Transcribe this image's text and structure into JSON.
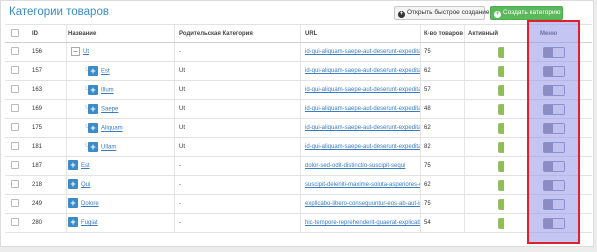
{
  "header": {
    "title": "Категории товаров",
    "quick_create_label": "Открыть быстрое создание",
    "create_label": "Создать категорию"
  },
  "columns": {
    "id": "ID",
    "name": "Название",
    "parent": "Родительская Категория",
    "url": "URL",
    "count": "К-во товаров",
    "active": "Активный",
    "menu": "Меню"
  },
  "rows": [
    {
      "id": "156",
      "name": "Ut",
      "level": 0,
      "expanded": true,
      "parent": "-",
      "url": "id-qui-aliquam-saepe-aut-deserunt-expedita",
      "count": "75",
      "active": true,
      "menu": false
    },
    {
      "id": "157",
      "name": "Est",
      "level": 1,
      "parent": "Ut",
      "url": "id-qui-aliquam-saepe-aut-deserunt-expedita/recusan...",
      "count": "62",
      "active": true,
      "menu": false
    },
    {
      "id": "163",
      "name": "Illum",
      "level": 1,
      "parent": "Ut",
      "url": "id-qui-aliquam-saepe-aut-deserunt-expedita/qui-dolo...",
      "count": "57",
      "active": true,
      "menu": false
    },
    {
      "id": "169",
      "name": "Saepe",
      "level": 1,
      "parent": "Ut",
      "url": "id-qui-aliquam-saepe-aut-deserunt-expedita/corporis...",
      "count": "48",
      "active": true,
      "menu": false
    },
    {
      "id": "175",
      "name": "Aliquam",
      "level": 1,
      "parent": "Ut",
      "url": "id-qui-aliquam-saepe-aut-deserunt-expedita/explicab...",
      "count": "62",
      "active": true,
      "menu": false
    },
    {
      "id": "181",
      "name": "Ullam",
      "level": 1,
      "parent": "Ut",
      "url": "id-qui-aliquam-saepe-aut-deserunt-expedita/quia-offi...",
      "count": "82",
      "active": true,
      "menu": false
    },
    {
      "id": "187",
      "name": "Est",
      "level": 0,
      "parent": "-",
      "url": "dolor-sed-odit-distinctio-suscipit-sequi",
      "count": "75",
      "active": true,
      "menu": false
    },
    {
      "id": "218",
      "name": "Qui",
      "level": 0,
      "parent": "-",
      "url": "suscipit-deleniti-maxime-soluta-asperiores-excepturi",
      "count": "62",
      "active": true,
      "menu": false
    },
    {
      "id": "249",
      "name": "Dolore",
      "level": 0,
      "parent": "-",
      "url": "explicabo-libero-consequuntur-eos-ab-aut-impedit-vo...",
      "count": "75",
      "active": true,
      "menu": false
    },
    {
      "id": "280",
      "name": "Fugiat",
      "level": 0,
      "parent": "-",
      "url": "hic-tempore-reprehenderit-quaerat-explicabo-sed-dig...",
      "count": "54",
      "active": true,
      "menu": false
    }
  ],
  "colors": {
    "title": "#3a8bc8",
    "create_button": "#5cb85c",
    "active_toggle": "#8bc34a",
    "menu_highlight": "#9696eb",
    "menu_frame": "#e0202a"
  }
}
